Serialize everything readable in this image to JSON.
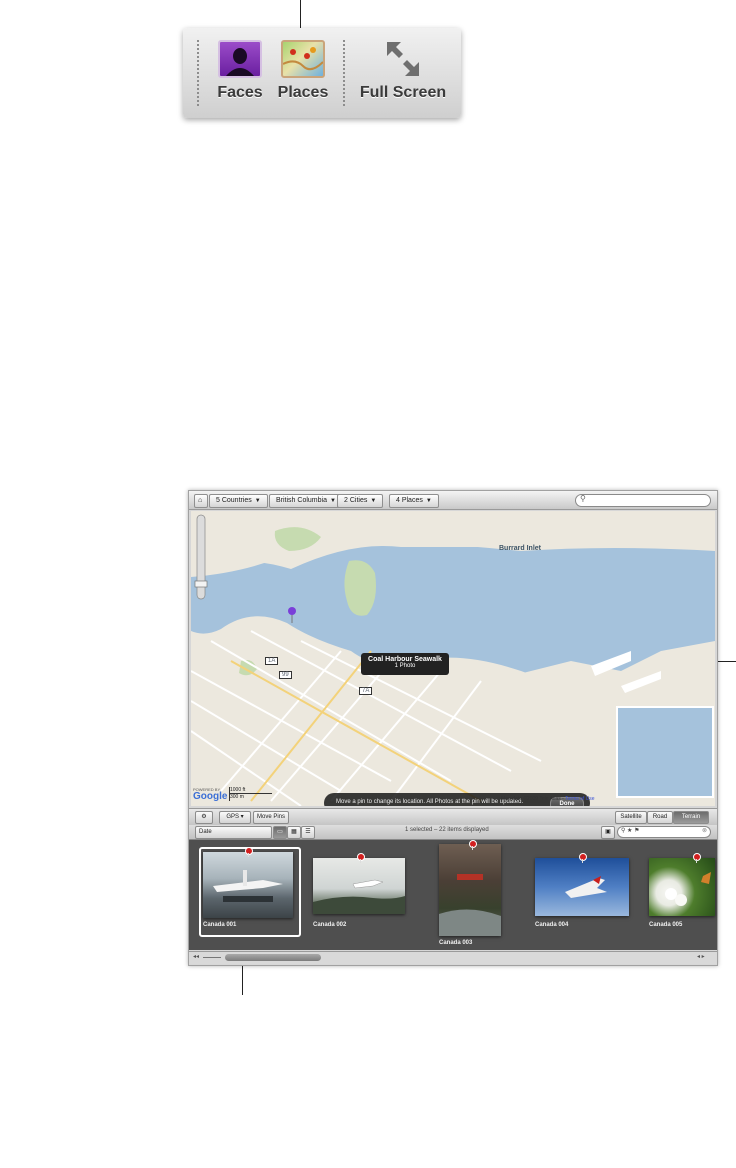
{
  "toolbar": {
    "faces_label": "Faces",
    "places_label": "Places",
    "fullscreen_label": "Full Screen"
  },
  "breadcrumbs": [
    {
      "label": "5 Countries"
    },
    {
      "label": "British Columbia"
    },
    {
      "label": "2 Cities"
    },
    {
      "label": "4 Places"
    }
  ],
  "map": {
    "water_label": "Burrard Inlet",
    "popup_title": "Coal Harbour Seawalk",
    "popup_subtitle": "1 Photo",
    "hint_text": "Move a pin to change its location. All Photos at the pin will be updated.",
    "done_label": "Done",
    "scale_ft": "1000 ft",
    "scale_m": "300 m",
    "powered_by": "POWERED BY",
    "google": "Google",
    "copyright": "Map data ©2009 Tele Atlas -",
    "terms": "Terms of Use",
    "hwy_1a": "1A",
    "hwy_99": "99",
    "hwy_7a": "7A"
  },
  "map_toolbar": {
    "gps_label": "GPS",
    "move_pins_label": "Move Pins",
    "satellite_label": "Satellite",
    "road_label": "Road",
    "terrain_label": "Terrain"
  },
  "filter_bar": {
    "sort_label": "Date",
    "status_text": "1 selected – 22 items displayed"
  },
  "photos": [
    {
      "caption": "Canada 001"
    },
    {
      "caption": "Canada 002"
    },
    {
      "caption": "Canada 003"
    },
    {
      "caption": "Canada 004"
    },
    {
      "caption": "Canada 005"
    }
  ],
  "colors": {
    "water": "#a5c2dc",
    "land": "#ece8de",
    "park": "#c6dbb0",
    "pin_purple": "#7a3fd9",
    "pin_red": "#d21f1f"
  }
}
